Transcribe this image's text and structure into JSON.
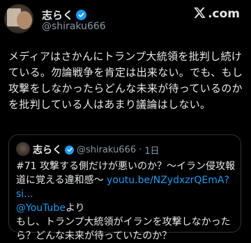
{
  "tweet": {
    "display_name": "志らく",
    "handle": "@shiraku666",
    "body": "メディアはさかんにトランプ大統領を批判し続けている。勿論戦争を肯定は出来ない。でも、もし攻撃をしなかったらどんな未来が待っているのかを批判している人はあまり議論はしない。"
  },
  "brand": {
    "logo_text": ".com",
    "logo_icon": "x-logo-icon"
  },
  "quote": {
    "display_name": "志らく",
    "handle": "@shiraku666",
    "separator": "·",
    "time": "1日",
    "text_line1": "#71 攻撃する側だけが悪いのか？〜イラン侵攻報道に覚える違和感〜 ",
    "link1": "youtu.be/NZydxzrQEmA?si...",
    "link2": "@YouTube",
    "text_after_link2": "より",
    "text_line3": "もし、トランプ大統領がイランを攻撃しなかったら？どんな未来が待っていたのか？"
  },
  "colors": {
    "background": "#000000",
    "text": "#e7e9ea",
    "secondary": "#8b98a5",
    "accent": "#1d9bf0"
  }
}
